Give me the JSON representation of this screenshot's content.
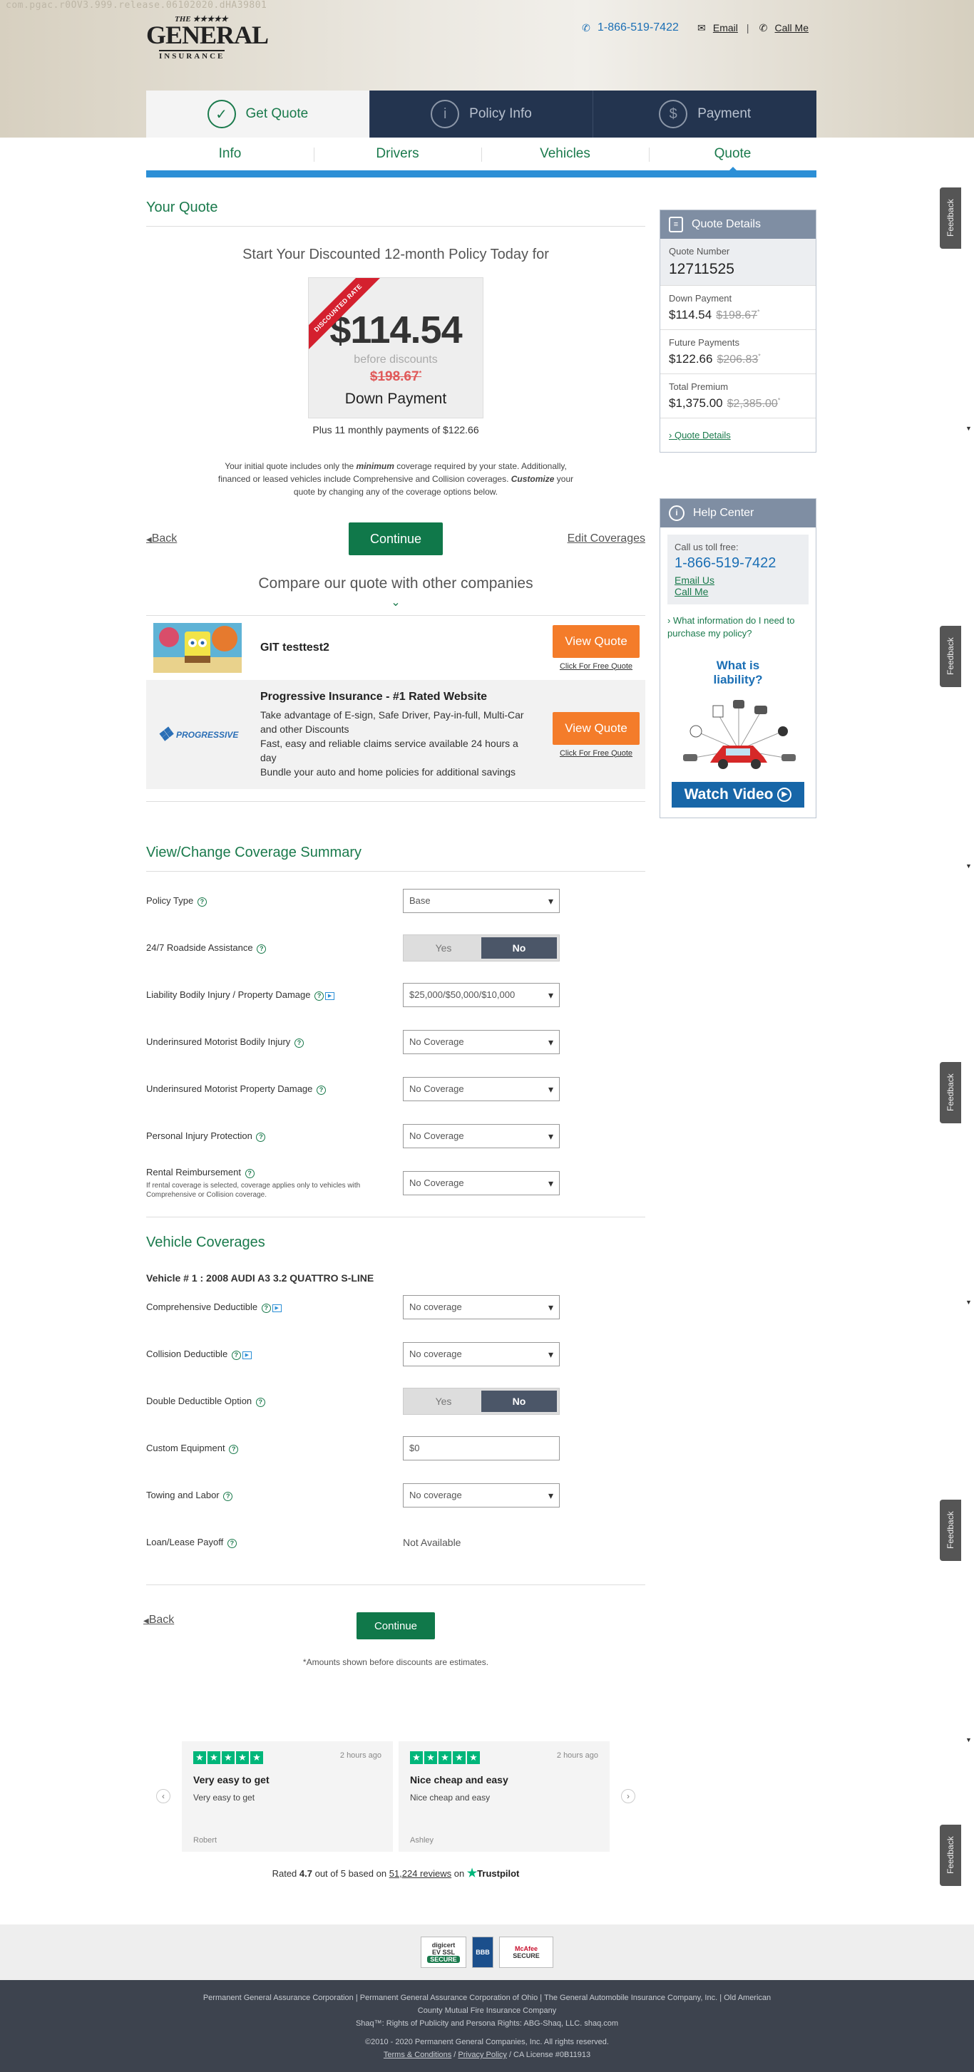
{
  "watermark": "com.pgac.r0OV3.999.release.06102020.dHA39801",
  "brand": {
    "the": "THE ★★★★★",
    "general": "GENERAL",
    "insurance": "INSURANCE"
  },
  "header": {
    "phone": "1-866-519-7422",
    "email": "Email",
    "call_me": "Call Me",
    "sep": "|"
  },
  "steps": [
    {
      "label": "Get Quote",
      "icon": "check-icon"
    },
    {
      "label": "Policy Info",
      "icon": "info-icon"
    },
    {
      "label": "Payment",
      "icon": "dollar-icon"
    }
  ],
  "subtabs": [
    "Info",
    "Drivers",
    "Vehicles",
    "Quote"
  ],
  "quote": {
    "heading": "Your Quote",
    "intro": "Start Your Discounted 12-month Policy Today for",
    "ribbon": "DISCOUNTED RATE",
    "price": "$114.54",
    "before": "before discounts",
    "strike_price": "$198.67",
    "strike_mark": "*",
    "down_label": "Down Payment",
    "monthly": "Plus 11 monthly payments of $122.66",
    "disc_1": "Your initial quote includes only the ",
    "disc_min": "minimum",
    "disc_2": " coverage required by your state. Additionally, financed or leased vehicles include Comprehensive and Collision coverages. ",
    "disc_cust": "Customize",
    "disc_3": " your quote by changing any of the coverage options below.",
    "back": "Back",
    "continue": "Continue",
    "edit": "Edit Coverages"
  },
  "compare": {
    "title": "Compare our quote with other companies",
    "companies": [
      {
        "name": "GIT testtest2",
        "button": "View Quote",
        "link": "Click For Free Quote"
      },
      {
        "name": "Progressive Insurance - #1 Rated Website",
        "logo": "PROGRESSIVE",
        "desc1": "Take advantage of E-sign, Safe Driver, Pay-in-full, Multi-Car and other Discounts",
        "desc2": "Fast, easy and reliable claims service available 24 hours a day",
        "desc3": "Bundle your auto and home policies for additional savings",
        "button": "View Quote",
        "link": "Click For Free Quote"
      }
    ]
  },
  "coverage": {
    "title": "View/Change Coverage Summary",
    "rows": [
      {
        "label": "Policy Type",
        "value": "Base"
      },
      {
        "label": "24/7 Roadside Assistance",
        "yes": "Yes",
        "no": "No"
      },
      {
        "label": "Liability Bodily Injury / Property Damage",
        "value": "$25,000/$50,000/$10,000"
      },
      {
        "label": "Underinsured Motorist Bodily Injury",
        "value": "No Coverage"
      },
      {
        "label": "Underinsured Motorist Property Damage",
        "value": "No Coverage"
      },
      {
        "label": "Personal Injury Protection",
        "value": "No Coverage"
      },
      {
        "label": "Rental Reimbursement",
        "note": "If rental coverage is selected, coverage applies only to vehicles with Comprehensive or Collision coverage.",
        "value": "No Coverage"
      }
    ]
  },
  "vehicle": {
    "title": "Vehicle Coverages",
    "vehicle_name": "Vehicle # 1 : 2008 AUDI A3 3.2 QUATTRO S-LINE",
    "rows": [
      {
        "label": "Comprehensive Deductible",
        "value": "No coverage"
      },
      {
        "label": "Collision Deductible",
        "value": "No coverage"
      },
      {
        "label": "Double Deductible Option",
        "yes": "Yes",
        "no": "No"
      },
      {
        "label": "Custom Equipment",
        "value": "$0"
      },
      {
        "label": "Towing and Labor",
        "value": "No coverage"
      },
      {
        "label": "Loan/Lease Payoff",
        "value": "Not Available"
      }
    ],
    "back": "Back",
    "continue": "Continue",
    "estimate_note": "*Amounts shown before discounts are estimates."
  },
  "reviews": {
    "items": [
      {
        "time": "2 hours ago",
        "title": "Very easy to get",
        "body": "Very easy to get",
        "author": "Robert"
      },
      {
        "time": "2 hours ago",
        "title": "Nice cheap and easy",
        "body": "Nice cheap and easy",
        "author": "Ashley"
      }
    ],
    "rated": "Rated ",
    "score": "4.7",
    "outof": " out of 5 based on ",
    "count": "51,224 reviews",
    "on": " on ",
    "brand": "Trustpilot",
    "stars": 5
  },
  "quote_details": {
    "title": "Quote Details",
    "number_label": "Quote Number",
    "number": "12711525",
    "down_label": "Down Payment",
    "down": "$114.54",
    "down_old": "$198.67",
    "future_label": "Future Payments",
    "future": "$122.66",
    "future_old": "$206.83",
    "total_label": "Total Premium",
    "total": "$1,375.00",
    "total_old": "$2,385.00",
    "mark": "*",
    "link": "Quote Details"
  },
  "help": {
    "title": "Help Center",
    "call": "Call us toll free:",
    "phone": "1-866-519-7422",
    "email": "Email Us",
    "call_me": "Call Me",
    "question": "What information do I need to purchase my policy?",
    "liab_1": "What is",
    "liab_2": "liability?",
    "video": "Watch Video"
  },
  "feedback": "Feedback",
  "badges": [
    {
      "line1": "digicert",
      "line2": "EV SSL",
      "line3": "SECURE"
    },
    {
      "line1": "BBB",
      "line2": "",
      "line3": ""
    },
    {
      "line1": "McAfee",
      "line2": "SECURE",
      "line3": ""
    }
  ],
  "footer": {
    "line1": "Permanent General Assurance Corporation | Permanent General Assurance Corporation of Ohio | The General Automobile Insurance Company, Inc. | Old American",
    "line2": "County Mutual Fire Insurance Company",
    "line3": "Shaq™: Rights of Publicity and Persona Rights: ABG-Shaq, LLC. shaq.com",
    "copyright": "©2010 - 2020 Permanent General Companies, Inc. All rights reserved.",
    "terms": "Terms & Conditions",
    "privacy": "Privacy Policy",
    "license": " / CA License #0B11913"
  },
  "colors": {
    "brand_green": "#10784a",
    "navy": "#23344f",
    "accent_blue": "#2c8fd6",
    "orange": "#f47c2a",
    "trustpilot": "#00b67a"
  }
}
